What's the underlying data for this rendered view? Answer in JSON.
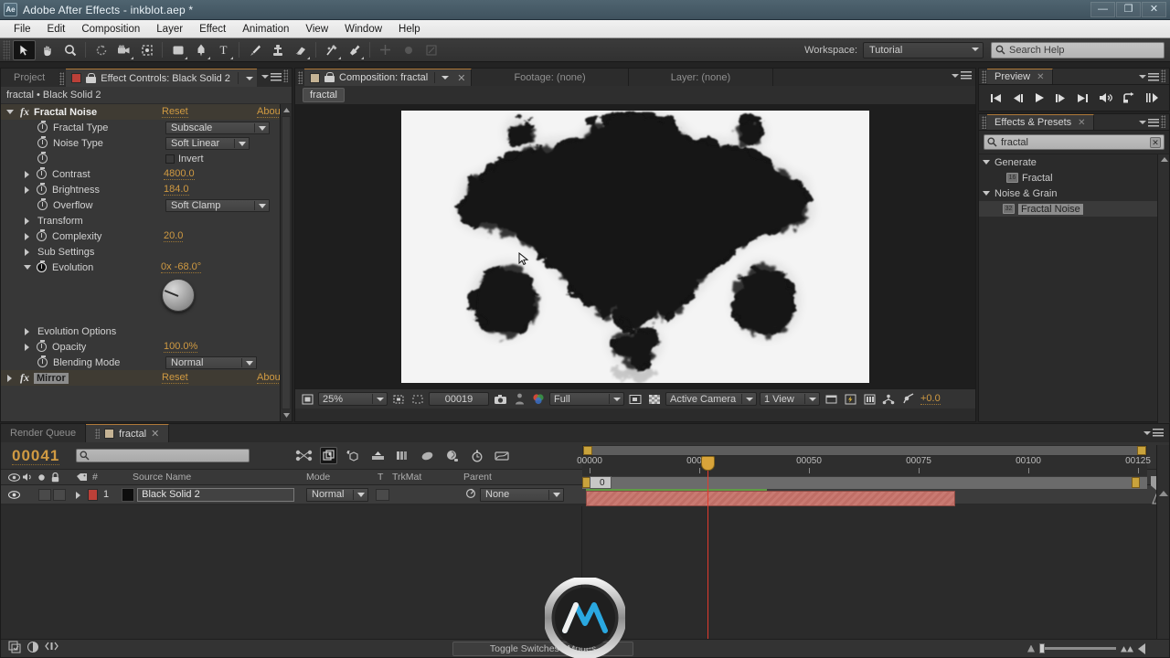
{
  "window": {
    "title": "Adobe After Effects - inkblot.aep *",
    "app_badge": "Ae",
    "minimize": "—",
    "maximize": "❐",
    "close": "✕"
  },
  "menubar": {
    "items": [
      "File",
      "Edit",
      "Composition",
      "Layer",
      "Effect",
      "Animation",
      "View",
      "Window",
      "Help"
    ]
  },
  "toolbar": {
    "tools": [
      {
        "name": "selection-tool",
        "glyph": "➤",
        "selected": true
      },
      {
        "name": "hand-tool",
        "glyph": "✋",
        "selected": false
      },
      {
        "name": "zoom-tool",
        "glyph": "ὐD",
        "selected": false
      },
      {
        "name": "rotation-tool",
        "glyph": "↻",
        "selected": false
      },
      {
        "name": "camera-tool",
        "glyph": "Ἲ5",
        "selected": false
      },
      {
        "name": "pan-behind-tool",
        "glyph": "⬚",
        "selected": false
      },
      {
        "name": "shape-tool",
        "glyph": "■",
        "selected": false
      },
      {
        "name": "pen-tool",
        "glyph": "✒",
        "selected": false
      },
      {
        "name": "type-tool",
        "glyph": "T",
        "selected": false
      },
      {
        "name": "brush-tool",
        "glyph": "╱",
        "selected": false
      },
      {
        "name": "clone-stamp-tool",
        "glyph": "⚙",
        "selected": false
      },
      {
        "name": "eraser-tool",
        "glyph": "▰",
        "selected": false
      },
      {
        "name": "roto-brush-tool",
        "glyph": "✐",
        "selected": false
      },
      {
        "name": "puppet-pin-tool",
        "glyph": "ὌC",
        "selected": false
      }
    ],
    "workspace_label": "Workspace:",
    "workspace_value": "Tutorial",
    "search_help_placeholder": "Search Help"
  },
  "effect_controls": {
    "tab_project": "Project",
    "tab_title": "Effect Controls: Black Solid 2",
    "breadcrumb": "fractal • Black Solid 2",
    "effects": [
      {
        "name": "Fractal Noise",
        "reset": "Reset",
        "about": "Abou",
        "properties": [
          {
            "label": "Fractal Type",
            "type": "dropdown",
            "value": "Subscale",
            "stopwatch": true,
            "twirl": false
          },
          {
            "label": "Noise Type",
            "type": "dropdown",
            "value": "Soft Linear",
            "stopwatch": true,
            "twirl": false
          },
          {
            "label": "",
            "type": "checkbox",
            "value": "Invert",
            "stopwatch": true,
            "twirl": false
          },
          {
            "label": "Contrast",
            "type": "number",
            "value": "4800.0",
            "stopwatch": true,
            "twirl": true
          },
          {
            "label": "Brightness",
            "type": "number",
            "value": "184.0",
            "stopwatch": true,
            "twirl": true
          },
          {
            "label": "Overflow",
            "type": "dropdown",
            "value": "Soft Clamp",
            "stopwatch": true,
            "twirl": false
          },
          {
            "label": "Transform",
            "type": "group",
            "value": "",
            "stopwatch": false,
            "twirl": true
          },
          {
            "label": "Complexity",
            "type": "number",
            "value": "20.0",
            "stopwatch": true,
            "twirl": true
          },
          {
            "label": "Sub Settings",
            "type": "group",
            "value": "",
            "stopwatch": false,
            "twirl": true
          },
          {
            "label": "Evolution",
            "type": "angle",
            "value": "0x -68.0°",
            "stopwatch": true,
            "twirl": true
          },
          {
            "label": "Evolution Options",
            "type": "group",
            "value": "",
            "stopwatch": false,
            "twirl": true
          },
          {
            "label": "Opacity",
            "type": "number",
            "value": "100.0%",
            "stopwatch": true,
            "twirl": true
          },
          {
            "label": "Blending Mode",
            "type": "dropdown",
            "value": "Normal",
            "stopwatch": true,
            "twirl": false
          }
        ]
      },
      {
        "name": "Mirror",
        "reset": "Reset",
        "about": "Abou",
        "properties": []
      }
    ]
  },
  "composition": {
    "tabs": [
      {
        "label": "Composition: fractal",
        "active": true,
        "closable": true
      },
      {
        "label": "Footage: (none)",
        "active": false,
        "closable": false
      },
      {
        "label": "Layer: (none)",
        "active": false,
        "closable": false
      }
    ],
    "breadcrumb_chip": "fractal",
    "bottom_bar": {
      "magnification": "25%",
      "current_time": "00019",
      "resolution": "Full",
      "camera": "Active Camera",
      "views": "1 View",
      "exposure": "+0.0"
    }
  },
  "preview": {
    "tab_label": "Preview",
    "buttons": [
      {
        "name": "first-frame-button",
        "glyph": "⏮"
      },
      {
        "name": "previous-frame-button",
        "glyph": "⏴"
      },
      {
        "name": "play-button",
        "glyph": "▶"
      },
      {
        "name": "next-frame-button",
        "glyph": "⏵"
      },
      {
        "name": "last-frame-button",
        "glyph": "⏭"
      },
      {
        "name": "audio-toggle-button",
        "glyph": "ὐA"
      },
      {
        "name": "loop-button",
        "glyph": "↻"
      },
      {
        "name": "ram-preview-button",
        "glyph": "▶"
      }
    ]
  },
  "effects_presets": {
    "tab_label": "Effects & Presets",
    "search_value": "fractal",
    "groups": [
      {
        "label": "Generate",
        "expanded": true,
        "items": [
          {
            "label": "Fractal",
            "bits": "16",
            "selected": false
          }
        ]
      },
      {
        "label": "Noise & Grain",
        "expanded": true,
        "items": [
          {
            "label": "Fractal Noise",
            "bits": "32",
            "selected": true
          }
        ]
      }
    ]
  },
  "timeline": {
    "tabs": [
      {
        "label": "Render Queue",
        "active": false
      },
      {
        "label": "fractal",
        "active": true
      }
    ],
    "current_time": "00041",
    "search_placeholder": "",
    "columns": [
      "Source Name",
      "Mode",
      "T",
      "TrkMat",
      "Parent"
    ],
    "layers": [
      {
        "index": "1",
        "name": "Black Solid 2",
        "mode": "Normal",
        "trkmat": "",
        "parent": "None",
        "color": "#bb4038",
        "visible": true
      }
    ],
    "ruler_labels": [
      "00000",
      "00025",
      "00050",
      "00075",
      "00100",
      "00125"
    ],
    "work_area_label": "0",
    "toggle_switches_label": "Toggle Switches / Modes"
  },
  "colors": {
    "accent_orange": "#d09a42",
    "tab_highlight": "#b07a3a",
    "layer_bar": "#c97a72",
    "cti_red": "#e23b2e",
    "panel_bg": "#2b2b2b",
    "ec_bg": "#373737"
  }
}
